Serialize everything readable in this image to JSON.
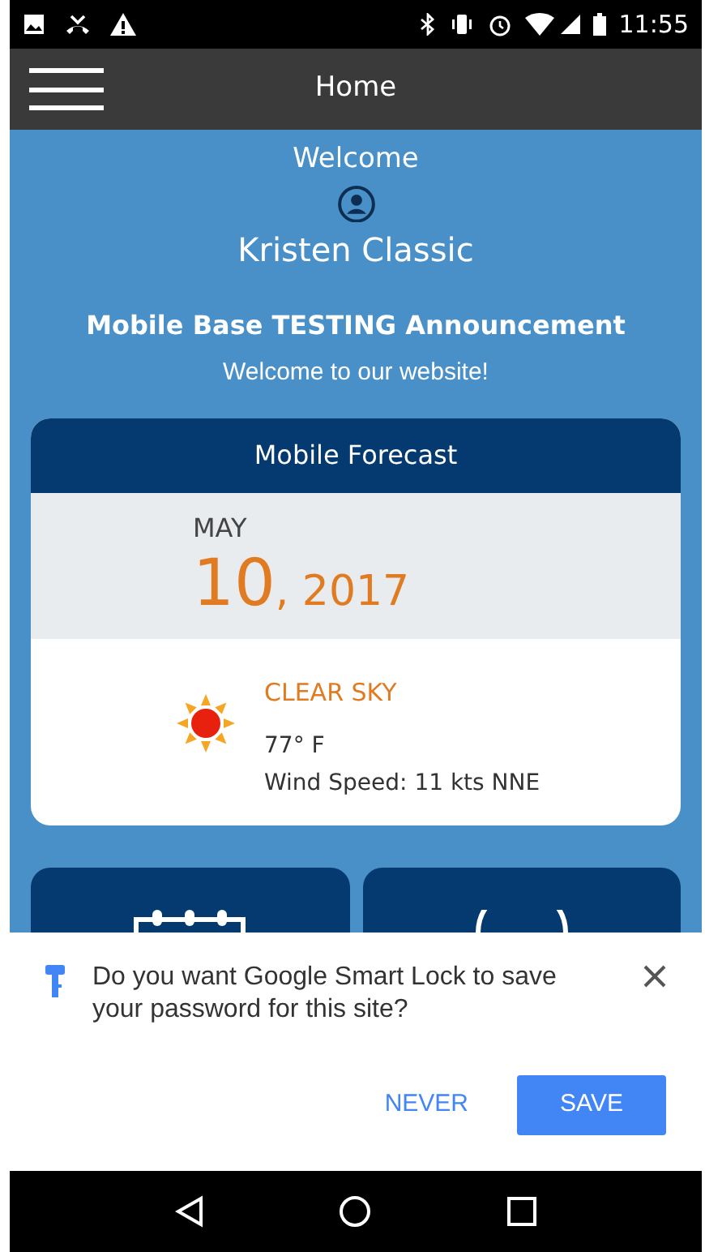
{
  "status_bar": {
    "time": "11:55"
  },
  "app_bar": {
    "title": "Home"
  },
  "welcome": {
    "label": "Welcome",
    "user_name": "Kristen Classic"
  },
  "announcement": {
    "title": "Mobile Base TESTING Announcement",
    "message": "Welcome to our website!"
  },
  "forecast": {
    "title": "Mobile Forecast",
    "month": "MAY",
    "day": "10",
    "year": ", 2017",
    "condition": "CLEAR SKY",
    "temperature": "77° F",
    "wind": "Wind Speed: 11 kts NNE"
  },
  "smart_lock": {
    "message": "Do you want Google Smart Lock to save your password for this site?",
    "buttons": [
      {
        "label": "NEVER",
        "kind": "text"
      },
      {
        "label": "SAVE",
        "kind": "filled"
      }
    ]
  }
}
